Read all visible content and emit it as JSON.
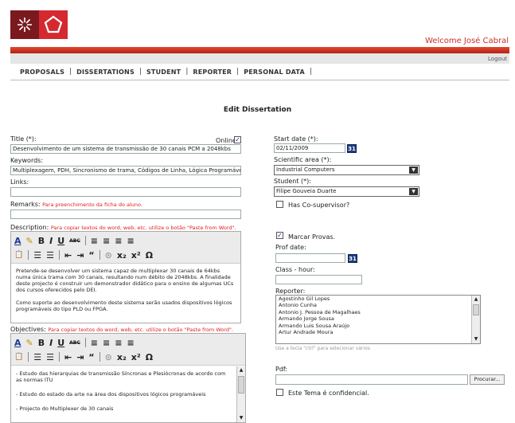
{
  "header": {
    "welcome": "Welcome José Cabral",
    "logout": "Logout",
    "nav": [
      "PROPOSALS",
      "DISSERTATIONS",
      "STUDENT",
      "REPORTER",
      "PERSONAL DATA"
    ],
    "colors": {
      "brand_dark": "#7a1a1f",
      "brand_red": "#d42a2f",
      "bar_red": "#c9302c"
    }
  },
  "page": {
    "title": "Edit Dissertation"
  },
  "form": {
    "title_label": "Title (*):",
    "online_label": "Online",
    "title_value": "Desenvolvimento de um sistema de transmissão de 30 canais PCM a 2048kbs",
    "keywords_label": "Keywords:",
    "keywords_value": "Multiplexagem, PDH, Sincronismo de trama, Códigos de Linha, Lógica Programável",
    "links_label": "Links:",
    "links_value": "",
    "remarks_label": "Remarks:",
    "remarks_hint": "Para preenchimento da ficha do aluno.",
    "remarks_value": "",
    "description_label": "Description:",
    "description_hint": "Para copiar textos do word, web, etc. utilize o botão \"Paste from Word\".",
    "description_text": [
      "Pretende-se desenvolver um sistema capaz de multiplexar 30 canais de 64kbs numa única trama com 30 canais, resultando num débito de 2048kbs. A finalidade deste projecto é construir um demonstrador didático para o ensino de algumas UCs dos cursos oferecidos pelo DEI.",
      "Como suporte ao desenvolvimento deste sistema serão usados dispositivos lógicos programáveis do tipo PLD ou FPGA."
    ],
    "objectives_label": "Objectives:",
    "objectives_hint": "Para copiar textos do word, web, etc. utilize o botão \"Paste from Word\".",
    "objectives_text": [
      "- Estudo das hierarquias de transmissão Síncronas e Plesiócronas de acordo com as normas ITU",
      "- Estudo do estado da arte na área dos dispositivos lógicos programáveis",
      "- Projecto do Multiplexer de 30 canais"
    ],
    "start_date_label": "Start date (*):",
    "start_date_value": "02/11/2009",
    "calendar_glyph": "31",
    "sci_area_label": "Scientific area (*):",
    "sci_area_value": "Industrial Computers",
    "student_label": "Student (*):",
    "student_value": "Filipe Gouveia Duarte",
    "cosupervisor_label": "Has Co-supervisor?",
    "marcar_label": "Marcar Provas.",
    "prof_date_label": "Prof date:",
    "class_hour_label": "Class - hour:",
    "reporter_label": "Reporter:",
    "reporters": [
      "Agostinho Gil Lopes",
      "Antonio Cunha",
      "Antonio J. Pessoa de Magalhaes",
      "Armando Jorge Sousa",
      "Armando Luis Sousa Araújo",
      "Artur Andrade Moura"
    ],
    "reporter_hint": "Use a tecla \"ctrl\" para selecionar vários",
    "pdf_label": "Pdf:",
    "browse_label": "Procurar...",
    "confidential_label": "Este Tema é confidencial."
  },
  "toolbar": {
    "row1": [
      "A",
      "✎",
      "B",
      "I",
      "U",
      "ABC",
      "≡",
      "≡",
      "≡",
      "≡"
    ],
    "row2": [
      "📋",
      "☰",
      "☰",
      "⇤",
      "⇥",
      "“",
      "⊙",
      "x₂",
      "x²",
      "Ω"
    ]
  }
}
